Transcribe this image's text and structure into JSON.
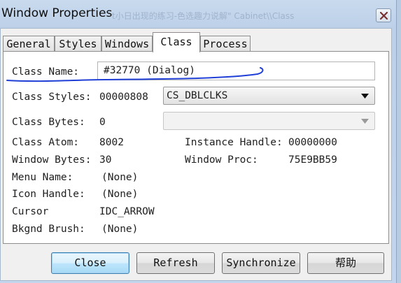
{
  "window": {
    "title": "Window Properties",
    "background_ghost_text": "t小日出现的练习-色选趣力说解\" Cabinet\\\\Class"
  },
  "tabs": [
    "General",
    "Styles",
    "Windows",
    "Class",
    "Process"
  ],
  "active_tab": "Class",
  "fields": {
    "class_name": {
      "label": "Class Name:",
      "value": "#32770 (Dialog)"
    },
    "class_styles": {
      "label": "Class Styles:",
      "value": "00000808",
      "combo_value": "CS_DBLCLKS"
    },
    "class_bytes": {
      "label": "Class Bytes:",
      "value": "0",
      "combo_value": ""
    },
    "class_atom": {
      "label": "Class Atom:",
      "value": "8002"
    },
    "instance_handle": {
      "label": "Instance Handle:",
      "value": "00000000"
    },
    "window_bytes": {
      "label": "Window Bytes:",
      "value": "30"
    },
    "window_proc": {
      "label": "Window Proc:",
      "value": "75E9BB59"
    },
    "menu_name": {
      "label": "Menu Name:",
      "value": "(None)"
    },
    "icon_handle": {
      "label": "Icon Handle:",
      "value": "(None)"
    },
    "cursor": {
      "label": "Cursor",
      "value": "IDC_ARROW"
    },
    "bkgnd_brush": {
      "label": "Bkgnd Brush:",
      "value": "(None)"
    }
  },
  "buttons": {
    "close": "Close",
    "refresh": "Refresh",
    "synchronize": "Synchronize",
    "help": "帮助"
  },
  "annotation": {
    "color": "#1f3fd6"
  }
}
